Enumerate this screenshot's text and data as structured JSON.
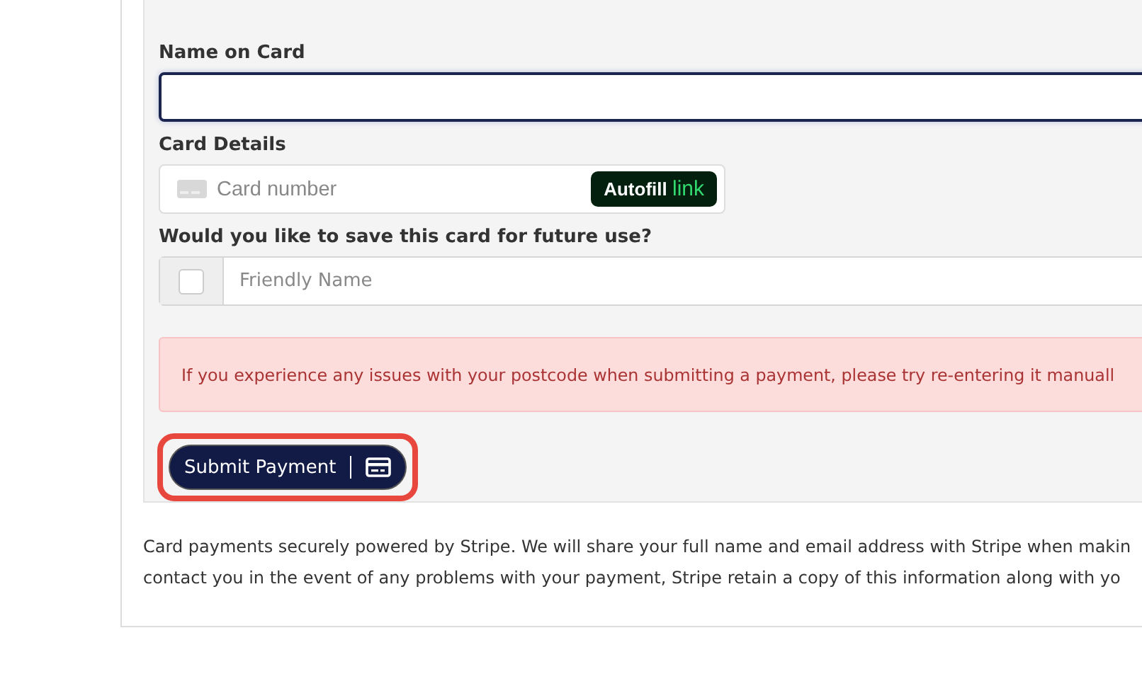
{
  "form": {
    "name_label": "Name on Card",
    "name_focused": true,
    "card_label": "Card Details",
    "card_placeholder": "Card number",
    "autofill": {
      "text": "Autofill",
      "brand": "link"
    },
    "save_label": "Would you like to save this card for future use?",
    "save_checked": false,
    "friendly_placeholder": "Friendly Name",
    "alert": "If you experience any issues with your postcode when submitting a payment, please try re-entering it manuall",
    "submit": {
      "label": "Submit Payment",
      "highlighted": true
    }
  },
  "notice_lines": [
    "Card payments securely powered by Stripe. We will share your full name and email address with Stripe when makin",
    "contact you in the event of any problems with your payment, Stripe retain a copy of this information along with yo"
  ]
}
